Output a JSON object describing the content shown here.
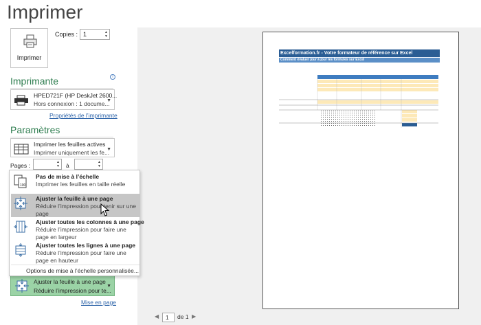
{
  "title": "Imprimer",
  "print_button": {
    "label": "Imprimer"
  },
  "copies": {
    "label": "Copies :",
    "value": "1"
  },
  "printer": {
    "heading": "Imprimante",
    "name": "HPED721F (HP DeskJet 2600...",
    "status": "Hors connexion : 1 docume...",
    "properties_link": "Propriétés de l’imprimante"
  },
  "settings": {
    "heading": "Paramètres",
    "what_to_print": {
      "line1": "Imprimer les feuilles actives",
      "line2": "Imprimer uniquement les fe..."
    },
    "pages_label": "Pages :",
    "to_label": "à"
  },
  "scaling_menu": {
    "items": [
      {
        "title": "Pas de mise à l’échelle",
        "desc": "Imprimer les feuilles en taille réelle"
      },
      {
        "title": "Ajuster la feuille à une page",
        "desc": "Réduire l’impression pour tenir sur une page"
      },
      {
        "title": "Ajuster toutes les colonnes à une page",
        "desc": "Réduire l’impression pour faire une page en largeur"
      },
      {
        "title": "Ajuster toutes les lignes à une page",
        "desc": "Réduire l’impression pour faire une page en hauteur"
      }
    ],
    "custom_option": "Options de mise à l’échelle personnalisée...",
    "selected_index": 1
  },
  "scaling_dropdown": {
    "line1": "Ajuster la feuille à une page",
    "line2": "Réduire l’impression pour te..."
  },
  "page_setup_link": "Mise en page",
  "pager": {
    "current": "1",
    "of_label": "de 1"
  },
  "preview": {
    "sheet_title": "Excelformation.fr - Votre formateur de référence sur Excel",
    "sheet_subtitle": "Comment évaluer jour à jour les formules sur Excel"
  },
  "colors": {
    "accent_green": "#2e7d4f",
    "selected_green": "#9bd3a6",
    "link_blue": "#2b62a8",
    "sheet_blue": "#2a5d94"
  }
}
